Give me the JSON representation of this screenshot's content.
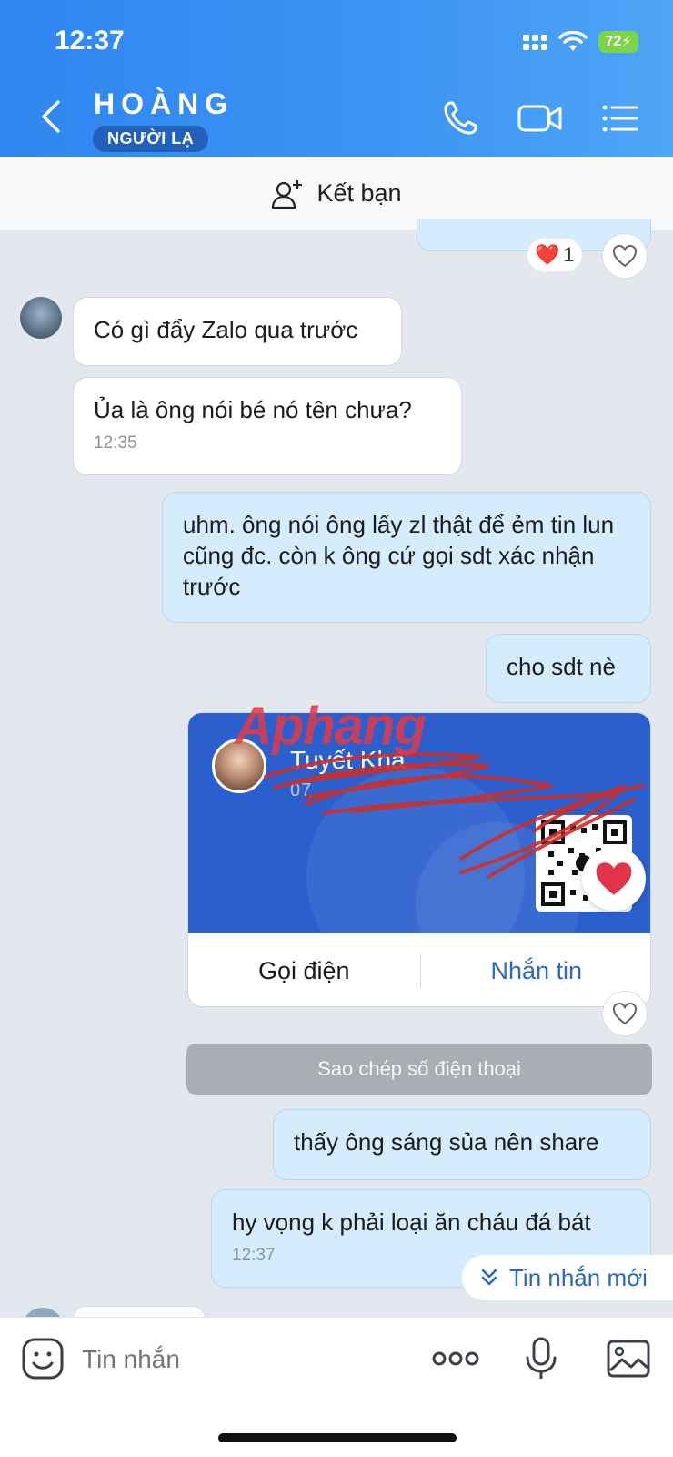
{
  "status_bar": {
    "time": "12:37",
    "battery": "72"
  },
  "header": {
    "name": "HOÀNG",
    "badge": "NGƯỜI LẠ"
  },
  "add_friend": {
    "label": "Kết bạn"
  },
  "reaction": {
    "emoji": "❤️",
    "count": "1"
  },
  "messages": [
    {
      "side": "in",
      "text": "Có gì đẩy Zalo qua trước"
    },
    {
      "side": "in",
      "text": "Ủa là ông nói bé nó tên chưa?",
      "time": "12:35"
    },
    {
      "side": "out",
      "text": "uhm. ông nói ông lấy zl thật để ẻm tin lun cũng đc. còn k ông cứ gọi sdt xác nhận trước"
    },
    {
      "side": "out",
      "text": "cho sdt nè"
    },
    {
      "side": "out",
      "text": "thấy ông sáng sủa nên share"
    },
    {
      "side": "out",
      "text": "hy vọng k phải loại ăn cháu đá bát",
      "time": "12:37"
    }
  ],
  "contact_card": {
    "name": "Tuyết Kha",
    "phone": "07",
    "call_label": "Gọi điện",
    "message_label": "Nhắn tin"
  },
  "watermark": "Aphang",
  "copy_phone_label": "Sao chép số điện thoại",
  "new_messages_label": "Tin nhắn mới",
  "input": {
    "placeholder": "Tin nhắn"
  },
  "colors": {
    "header": "#3a8ff2",
    "outgoing": "#d4ecfc",
    "accent": "#2c67c9"
  }
}
